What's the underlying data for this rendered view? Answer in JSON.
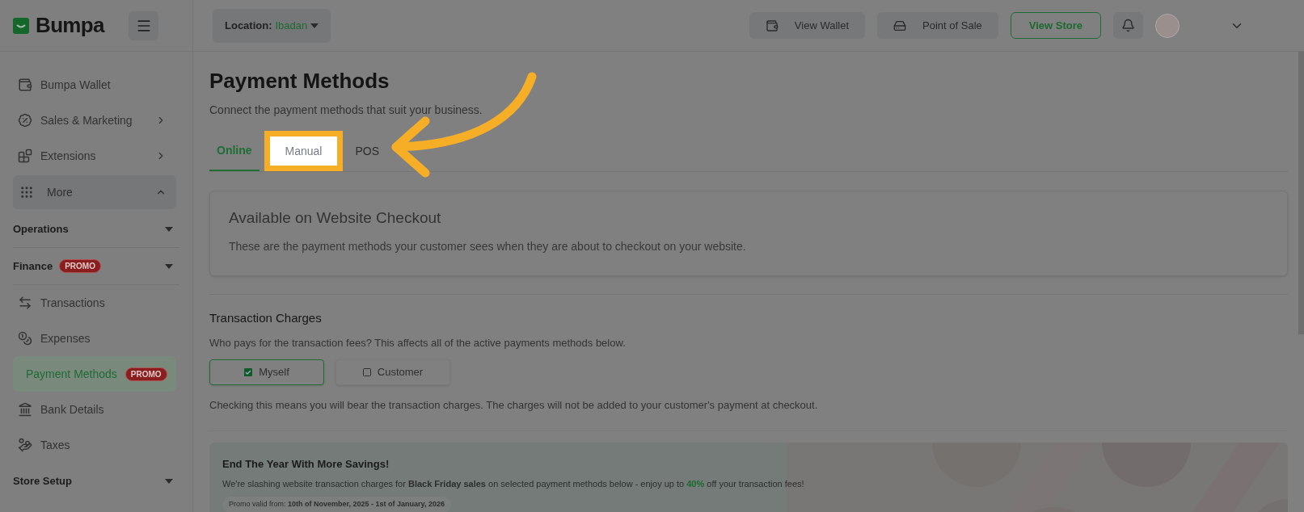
{
  "brand": {
    "name": "Bumpa"
  },
  "header": {
    "location_label": "Location:",
    "location_value": "Ibadan",
    "buttons": [
      {
        "label": "View Wallet",
        "kind": "wallet"
      },
      {
        "label": "Point of Sale",
        "kind": "pos"
      },
      {
        "label": "View Store",
        "kind": "outline"
      }
    ]
  },
  "sidebar": {
    "items": [
      {
        "kind": "item",
        "label": "Bumpa Wallet",
        "selected": false
      },
      {
        "kind": "item",
        "label": "Sales & Marketing",
        "selected": false,
        "chevron": true
      },
      {
        "kind": "item",
        "label": "Extensions",
        "selected": false,
        "chevron": true
      },
      {
        "kind": "toggle",
        "label": "More",
        "expanded": true
      },
      {
        "kind": "section",
        "label": "Operations"
      },
      {
        "kind": "section",
        "label": "Finance",
        "badge": "PROMO"
      },
      {
        "kind": "item",
        "label": "Transactions",
        "selected": false
      },
      {
        "kind": "item",
        "label": "Expenses",
        "selected": false
      },
      {
        "kind": "item",
        "label": "Payment Methods",
        "selected": true,
        "badge": "PROMO"
      },
      {
        "kind": "item",
        "label": "Bank Details",
        "selected": false
      },
      {
        "kind": "item",
        "label": "Taxes",
        "selected": false
      },
      {
        "kind": "section",
        "label": "Store Setup"
      }
    ]
  },
  "page": {
    "title": "Payment Methods",
    "subtitle": "Connect the payment methods that suit your business.",
    "tabs": [
      {
        "label": "Online",
        "selected": true,
        "highlighted": false
      },
      {
        "label": "Manual",
        "selected": false,
        "highlighted": true
      },
      {
        "label": "POS",
        "selected": false,
        "highlighted": false
      }
    ],
    "checkout_card": {
      "title": "Available on Website Checkout",
      "text": "These are the payment methods your customer sees when they are about to checkout on your website."
    },
    "charges": {
      "title": "Transaction Charges",
      "question": "Who pays for the transaction fees? This affects all of the active payments methods below.",
      "options": [
        {
          "label": "Myself",
          "checked": true
        },
        {
          "label": "Customer",
          "checked": false
        }
      ],
      "note": "Checking this means you will bear the transaction charges. The charges will not be added to your customer's payment at checkout."
    },
    "promo": {
      "title": "End The Year With More Savings!",
      "text": [
        {
          "kind": "plain",
          "text": "We're slashing website transaction charges for "
        },
        {
          "kind": "bold",
          "text": "Black Friday sales"
        },
        {
          "kind": "plain",
          "text": " on selected payment methods below - enjoy up to "
        },
        {
          "kind": "accent",
          "text": "40%"
        },
        {
          "kind": "plain",
          "text": " off your transaction fees!"
        }
      ],
      "valid_label": "Promo valid from:",
      "valid_value": "10th of November, 2025 - 1st of January, 2026"
    }
  }
}
